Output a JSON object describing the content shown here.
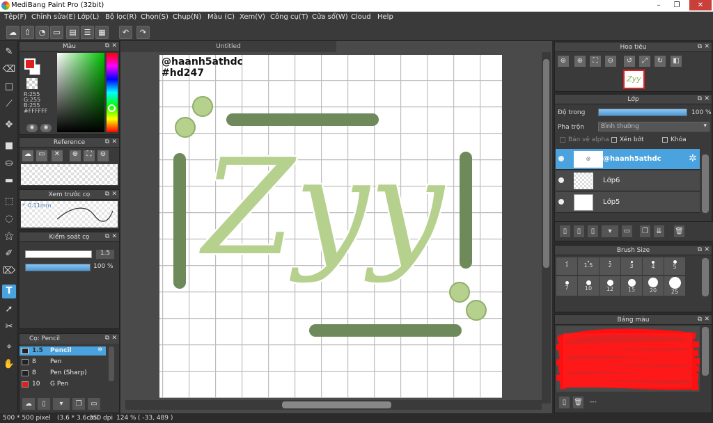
{
  "app": {
    "title": "MediBang Paint Pro (32bit)",
    "win_buttons": [
      "–",
      "❐",
      "✕"
    ]
  },
  "menu": [
    "Tệp(F)",
    "Chỉnh sửa(E)",
    "Lớp(L)",
    "Bộ lọc(R)",
    "Chọn(S)",
    "Chụp(N)",
    "Màu (C)",
    "Xem(V)",
    "Công cụ(T)",
    "Cửa sổ(W)",
    "Cloud",
    "Help"
  ],
  "toolbar": {
    "icons": [
      "cloud-icon",
      "export-icon",
      "chat-icon",
      "comment-icon",
      "page-icon",
      "list-icon",
      "grid-icon"
    ],
    "undo": "↶",
    "redo": "↷"
  },
  "color_panel": {
    "title": "Màu",
    "r": "R:255",
    "g": "G:255",
    "b": "B:255",
    "hex": "#FFFFFF",
    "primary": "#e02020",
    "secondary": "#ffffff"
  },
  "reference_panel": {
    "title": "Reference"
  },
  "brush_preview_panel": {
    "title": "Xem trước cọ",
    "size": "0.11mm"
  },
  "brush_control_panel": {
    "title": "Kiểm soát cọ",
    "size": "1.5",
    "opacity": "100 %",
    "opacity_frac": 1.0
  },
  "brush_list_panel": {
    "title": "Cọ: Pencil",
    "items": [
      {
        "size": "1.5",
        "name": "Pencil",
        "selected": true,
        "color": "#222222"
      },
      {
        "size": "8",
        "name": "Pen",
        "selected": false,
        "color": "#222222"
      },
      {
        "size": "8",
        "name": "Pen (Sharp)",
        "selected": false,
        "color": "#222222"
      },
      {
        "size": "10",
        "name": "G Pen",
        "selected": false,
        "color": "#e02020"
      }
    ]
  },
  "document": {
    "tab": "Untitled",
    "watermark_line1": "@haanh5athdc",
    "watermark_line2": "#hd247",
    "art_text": "Zyy",
    "exclaim": "!"
  },
  "navigator_panel": {
    "title": "Hoa tiêu",
    "thumb_text": "Zyy"
  },
  "layer_panel": {
    "title": "Lớp",
    "opacity_label": "Độ trong",
    "opacity_value": "100 %",
    "opacity_frac": 1.0,
    "blend_label": "Pha trộn",
    "blend_value": "Bình thường",
    "protect_alpha": "Bảo vệ alpha",
    "clipping": "Xén bớt",
    "lock": "Khóa",
    "layers": [
      {
        "name": "@haanh5athdc",
        "selected": true
      },
      {
        "name": "Lớp6",
        "selected": false
      },
      {
        "name": "Lớp5",
        "selected": false
      }
    ]
  },
  "brush_size_panel": {
    "title": "Brush Size",
    "sizes_row1": [
      "1",
      "1.5",
      "2",
      "3",
      "4",
      "5"
    ],
    "sizes_row2": [
      "7",
      "10",
      "12",
      "15",
      "20",
      "25"
    ]
  },
  "palette_panel": {
    "title": "Bảng màu",
    "footer": "---"
  },
  "status": {
    "dims": "500 * 500 pixel",
    "cm": "(3.6 * 3.6cm)",
    "dpi": "350 dpi",
    "zoom": "124 %",
    "coords": "( -33, 489 )"
  },
  "colors": {
    "accent": "#4aa3df",
    "art_green": "#b6d08e",
    "art_dark": "#6e8a5a"
  }
}
